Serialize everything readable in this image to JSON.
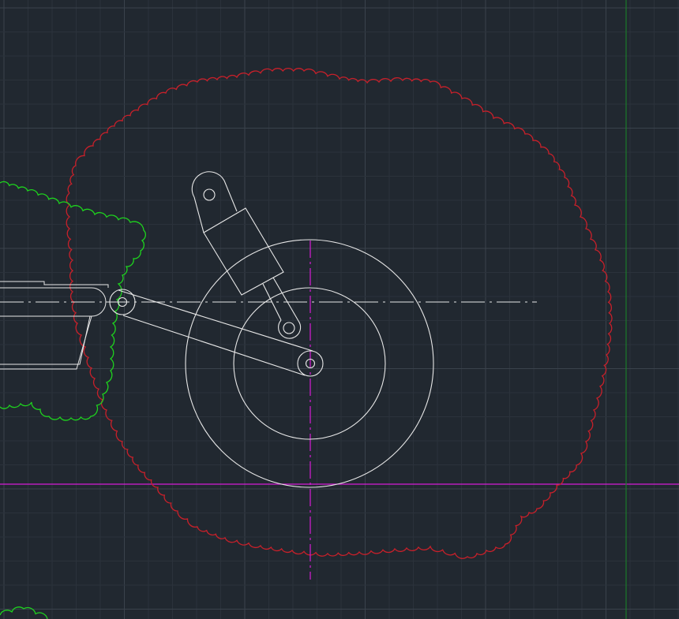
{
  "app": {
    "kind": "CAD drawing viewport",
    "background": "#212830"
  },
  "colors": {
    "grid_minor": "#2b323b",
    "grid_major": "#3a424c",
    "linework": "#e8e8e8",
    "revision_cloud_red": "#c8202a",
    "revision_cloud_green": "#1ed21e",
    "ucs_axis_magenta": "#d61cd6",
    "ucs_axis_green": "#1b7a2a"
  },
  "drawing": {
    "objects": [
      "wheel-outer-circle",
      "wheel-inner-circle",
      "axle-hub",
      "swing-arm",
      "shock-absorber",
      "frame-rail",
      "centerline-horizontal",
      "centerline-vertical",
      "revision-cloud-red",
      "revision-cloud-green"
    ]
  }
}
